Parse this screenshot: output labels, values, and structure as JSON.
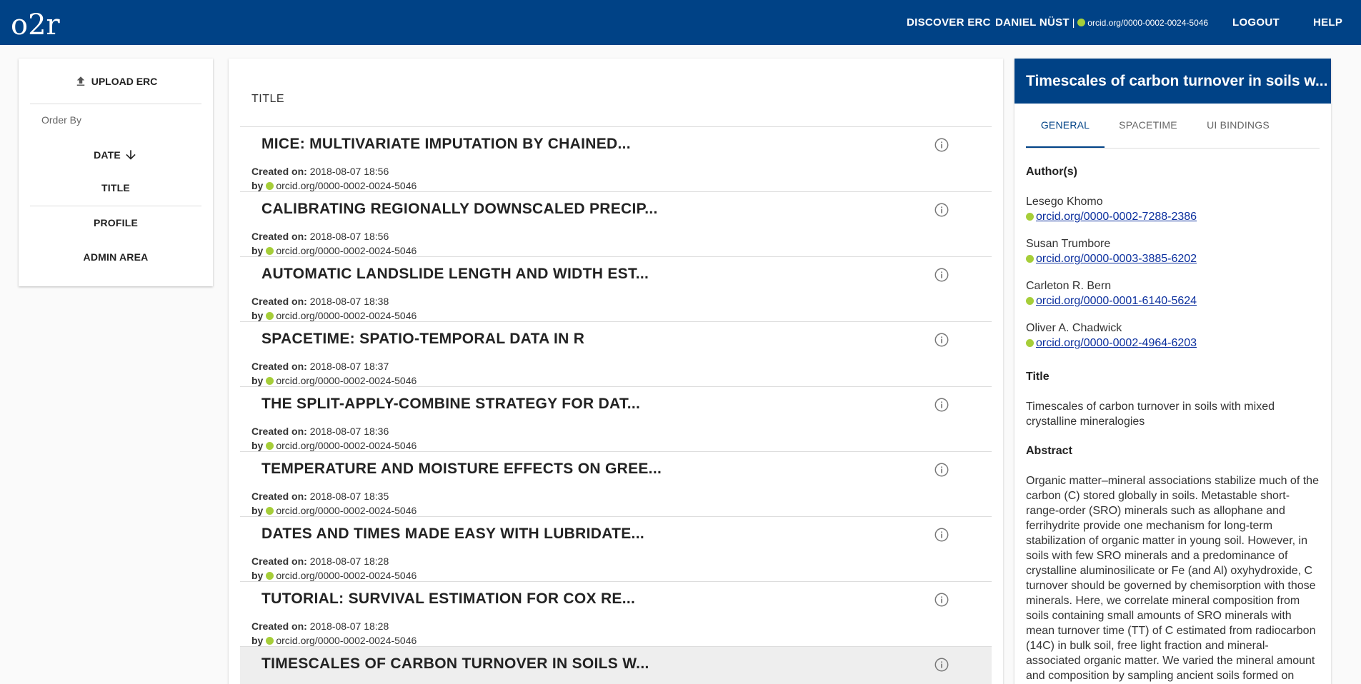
{
  "topbar": {
    "logo_text": "o2r",
    "nav_discover": "DISCOVER ERC",
    "user_name": "DANIEL NÜST",
    "user_separator": "|",
    "user_orcid": "orcid.org/0000-0002-0024-5046",
    "nav_logout": "LOGOUT",
    "nav_help": "HELP"
  },
  "sidebar": {
    "upload_label": "UPLOAD ERC",
    "order_by_label": "Order By",
    "sort_date": "DATE",
    "sort_title": "TITLE",
    "profile": "PROFILE",
    "admin_area": "ADMIN AREA"
  },
  "list": {
    "header": "TITLE",
    "created_label": "Created on:",
    "by_label": "by",
    "rows": [
      {
        "title": "MICE: MULTIVARIATE IMPUTATION BY CHAINED...",
        "created": "2018-08-07 18:56",
        "author": "orcid.org/0000-0002-0024-5046"
      },
      {
        "title": "CALIBRATING REGIONALLY DOWNSCALED PRECIP...",
        "created": "2018-08-07 18:56",
        "author": "orcid.org/0000-0002-0024-5046"
      },
      {
        "title": "AUTOMATIC LANDSLIDE LENGTH AND WIDTH EST...",
        "created": "2018-08-07 18:38",
        "author": "orcid.org/0000-0002-0024-5046"
      },
      {
        "title": "SPACETIME: SPATIO-TEMPORAL DATA IN R",
        "created": "2018-08-07 18:37",
        "author": "orcid.org/0000-0002-0024-5046"
      },
      {
        "title": "THE SPLIT-APPLY-COMBINE STRATEGY FOR DAT...",
        "created": "2018-08-07 18:36",
        "author": "orcid.org/0000-0002-0024-5046"
      },
      {
        "title": "TEMPERATURE AND MOISTURE EFFECTS ON GREE...",
        "created": "2018-08-07 18:35",
        "author": "orcid.org/0000-0002-0024-5046"
      },
      {
        "title": "DATES AND TIMES MADE EASY WITH LUBRIDATE...",
        "created": "2018-08-07 18:28",
        "author": "orcid.org/0000-0002-0024-5046"
      },
      {
        "title": "TUTORIAL: SURVIVAL ESTIMATION FOR COX RE...",
        "created": "2018-08-07 18:28",
        "author": "orcid.org/0000-0002-0024-5046"
      },
      {
        "title": "TIMESCALES OF CARBON TURNOVER IN SOILS W...",
        "created": "",
        "author": ""
      }
    ]
  },
  "detail": {
    "header": "Timescales of carbon turnover in soils w...",
    "tabs": [
      "GENERAL",
      "SPACETIME",
      "UI BINDINGS"
    ],
    "authors_label": "Author(s)",
    "authors": [
      {
        "name": "Lesego Khomo",
        "orcid": "orcid.org/0000-0002-7288-2386"
      },
      {
        "name": "Susan Trumbore",
        "orcid": "orcid.org/0000-0003-3885-6202"
      },
      {
        "name": "Carleton R. Bern",
        "orcid": "orcid.org/0000-0001-6140-5624"
      },
      {
        "name": "Oliver A. Chadwick",
        "orcid": "orcid.org/0000-0002-4964-6203"
      }
    ],
    "title_label": "Title",
    "title_text": "Timescales of carbon turnover in soils with mixed crystalline mineralogies",
    "abstract_label": "Abstract",
    "abstract_text": "Organic matter–mineral associations stabilize much of the carbon (C) stored globally in soils. Metastable short-range-order (SRO) minerals such as allophane and ferrihydrite provide one mechanism for long-term stabilization of organic matter in young soil. However, in soils with few SRO minerals and a predominance of crystalline aluminosilicate or Fe (and Al) oxyhydroxide, C turnover should be governed by chemisorption with those minerals. Here, we correlate mineral composition from soils containing small amounts of SRO minerals with mean turnover time (TT) of C estimated from radiocarbon (14C) in bulk soil, free light fraction and mineral-associated organic matter. We varied the mineral amount and composition by sampling ancient soils formed on"
  },
  "colors": {
    "brand": "#004286",
    "orcid": "#a6ce39",
    "link": "#0b2f9e"
  }
}
